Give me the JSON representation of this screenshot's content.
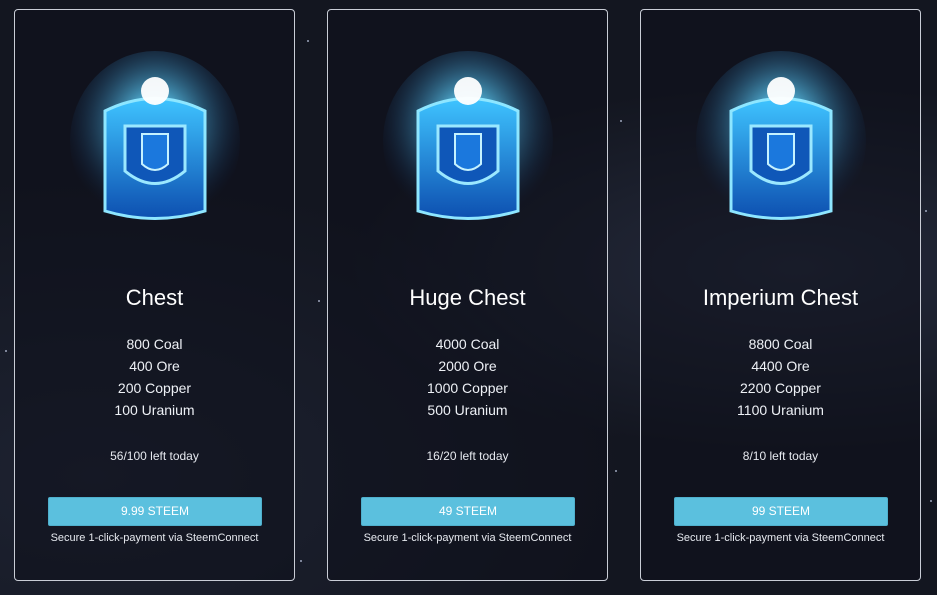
{
  "cards": [
    {
      "title": "Chest",
      "contents": [
        "800 Coal",
        "400 Ore",
        "200 Copper",
        "100 Uranium"
      ],
      "stock": "56/100 left today",
      "buy_label": "9.99 STEEM",
      "secure_note": "Secure 1-click-payment via SteemConnect"
    },
    {
      "title": "Huge Chest",
      "contents": [
        "4000 Coal",
        "2000 Ore",
        "1000 Copper",
        "500 Uranium"
      ],
      "stock": "16/20 left today",
      "buy_label": "49 STEEM",
      "secure_note": "Secure 1-click-payment via SteemConnect"
    },
    {
      "title": "Imperium Chest",
      "contents": [
        "8800 Coal",
        "4400 Ore",
        "2200 Copper",
        "1100 Uranium"
      ],
      "stock": "8/10 left today",
      "buy_label": "99 STEEM",
      "secure_note": "Secure 1-click-payment via SteemConnect"
    }
  ],
  "colors": {
    "background": "#131620",
    "card_border": "#c9cdd6",
    "button": "#5bc0de",
    "chest_glow": "#2fb8ff",
    "chest_body": "#1a6fd6"
  },
  "icons": {
    "chest": "glowing-blue-chest-icon"
  }
}
